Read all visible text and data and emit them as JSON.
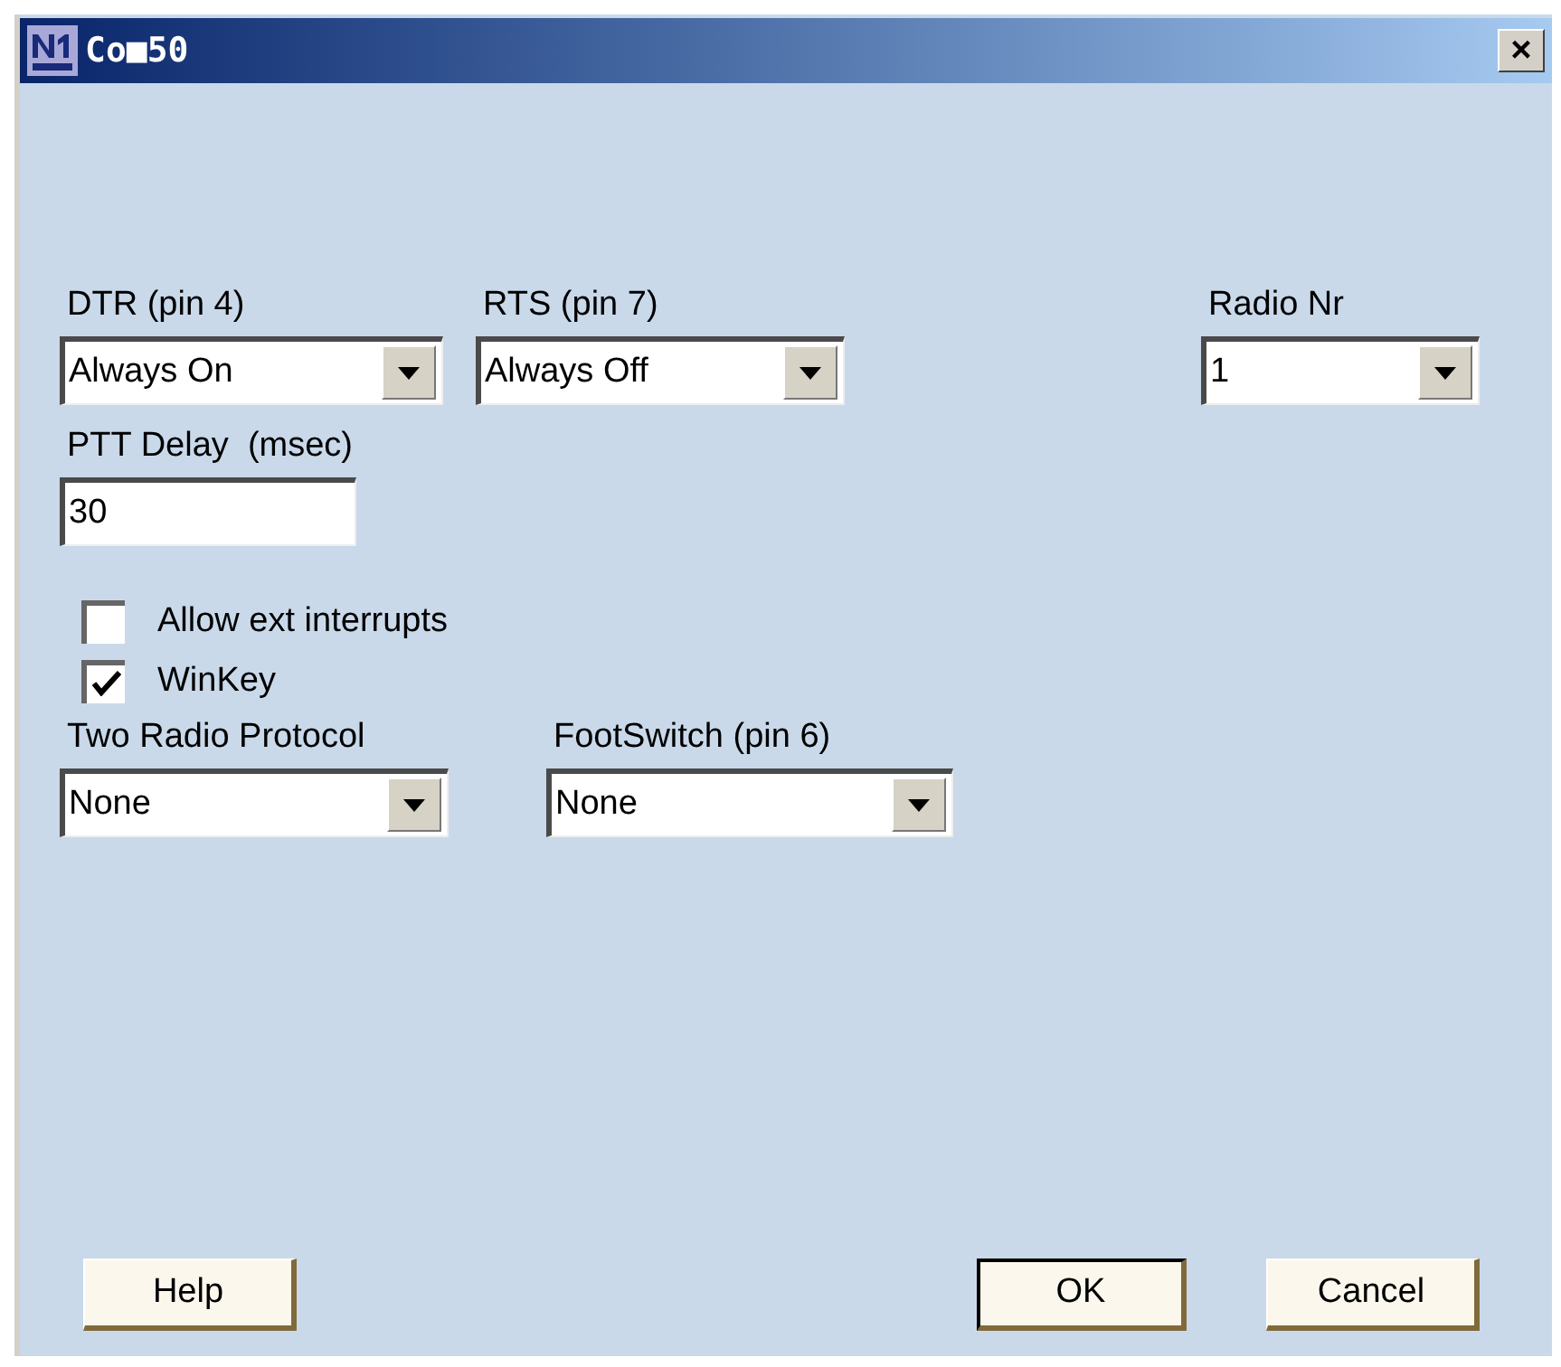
{
  "window": {
    "title": "Co■50",
    "close": "×"
  },
  "dtr": {
    "label": "DTR (pin 4)",
    "value": "Always On"
  },
  "rts": {
    "label": "RTS (pin 7)",
    "value": "Always Off"
  },
  "radio_nr": {
    "label": "Radio Nr",
    "value": "1"
  },
  "ptt_delay": {
    "label": "PTT Delay  (msec)",
    "value": "30"
  },
  "checkboxes": [
    {
      "label": "Allow ext interrupts",
      "checked": false
    },
    {
      "label": "WinKey",
      "checked": true
    }
  ],
  "two_radio_protocol": {
    "label": "Two Radio Protocol",
    "value": "None"
  },
  "footswitch": {
    "label": "FootSwitch (pin 6)",
    "value": "None"
  },
  "buttons": [
    {
      "label": "Help",
      "default": false
    },
    {
      "label": "OK",
      "default": true
    },
    {
      "label": "Cancel",
      "default": false
    }
  ]
}
